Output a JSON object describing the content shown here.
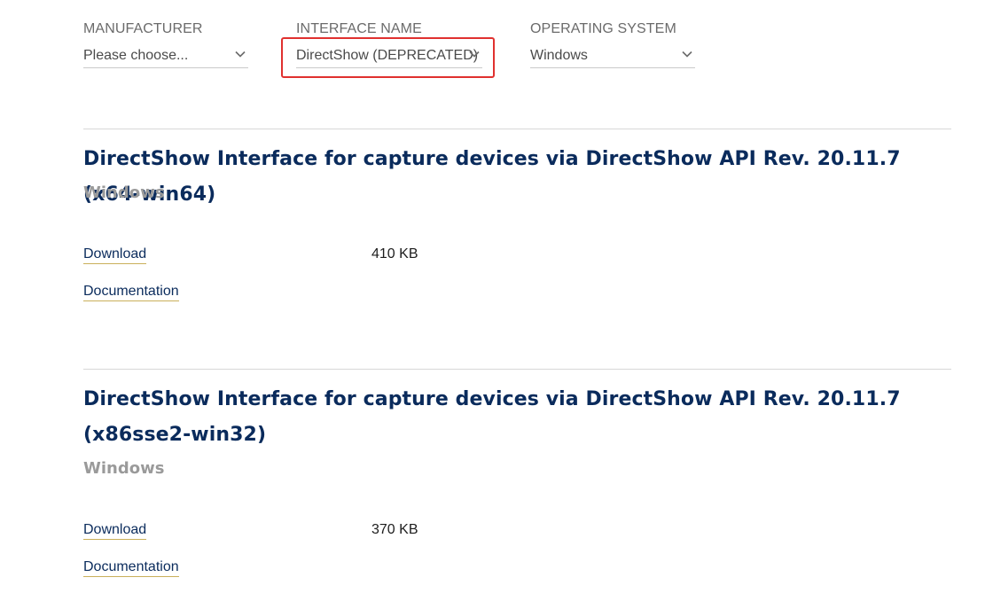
{
  "filters": {
    "manufacturer": {
      "label": "MANUFACTURER",
      "value": "Please choose..."
    },
    "interface_name": {
      "label": "INTERFACE NAME",
      "value": "DirectShow (DEPRECATED)"
    },
    "operating_system": {
      "label": "OPERATING SYSTEM",
      "value": "Windows"
    }
  },
  "results": [
    {
      "title": "DirectShow Interface for capture devices via DirectShow API Rev. 20.11.7 (x64-win64)",
      "os": "Windows",
      "download_label": "Download",
      "size": "410 KB",
      "documentation_label": "Documentation"
    },
    {
      "title": "DirectShow Interface for capture devices via DirectShow API Rev. 20.11.7 (x86sse2-win32)",
      "os": "Windows",
      "download_label": "Download",
      "size": "370 KB",
      "documentation_label": "Documentation"
    }
  ],
  "colors": {
    "title": "#0a2b5c",
    "muted": "#9a9a9a",
    "highlight": "#e0312f",
    "link_underline": "#c9b05a"
  },
  "icons": {
    "dropdown": "chevron-down-icon"
  }
}
